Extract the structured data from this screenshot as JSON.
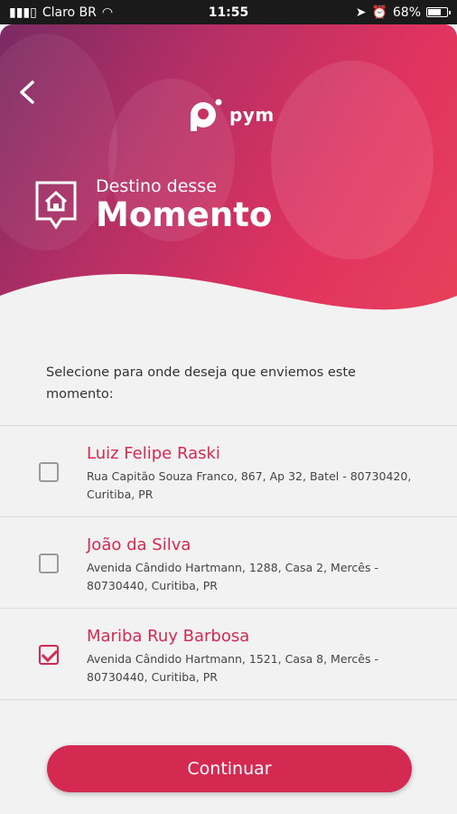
{
  "status_bar": {
    "carrier": "Claro BR",
    "time": "11:55",
    "battery": "68%",
    "battery_level": 0.68
  },
  "header": {
    "logo_text": "pym",
    "title_sub": "Destino desse",
    "title_main": "Momento"
  },
  "instruction": "Selecione para onde deseja que enviemos este momento:",
  "recipients": [
    {
      "name": "Luiz Felipe Raski",
      "address": "Rua Capitão Souza Franco, 867, Ap 32, Batel - 80730420, Curitiba, PR",
      "checked": false
    },
    {
      "name": "João da Silva",
      "address": "Avenida Cândido Hartmann, 1288, Casa 2, Mercês - 80730440, Curitiba, PR",
      "checked": false
    },
    {
      "name": "Mariba Ruy Barbosa",
      "address": "Avenida Cândido Hartmann, 1521, Casa 8, Mercês - 80730440, Curitiba, PR",
      "checked": true
    }
  ],
  "continue_label": "Continuar",
  "colors": {
    "accent": "#d42a52",
    "header_start": "#7a2a63",
    "header_end": "#e8405c"
  }
}
